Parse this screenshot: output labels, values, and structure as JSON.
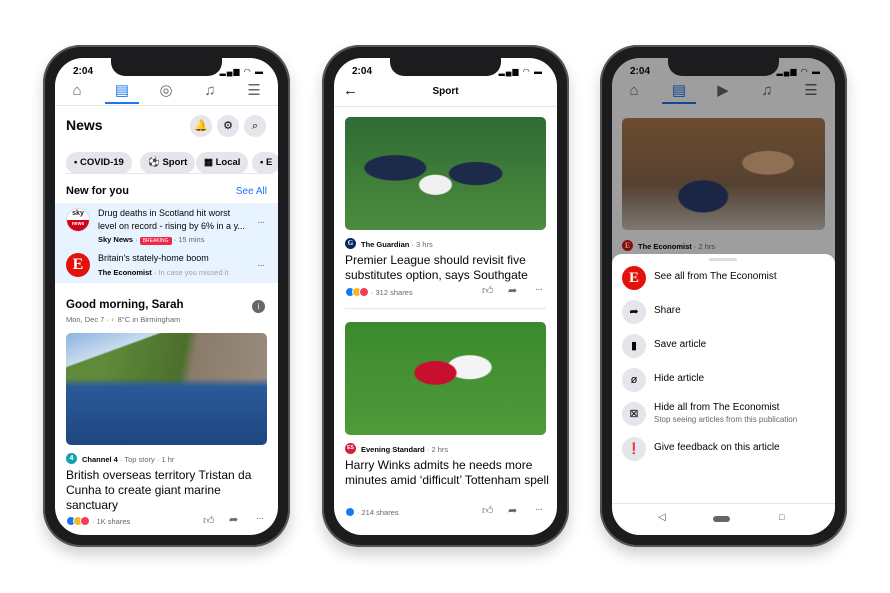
{
  "status_time": "2:04",
  "phone1": {
    "nav": [
      "home-icon",
      "news-icon",
      "groups-icon",
      "bell-icon",
      "menu-icon"
    ],
    "title": "News",
    "header_icons": [
      "bell-icon",
      "gear-icon",
      "search-icon"
    ],
    "chips": [
      {
        "label": "COVID-19",
        "icon": "briefcase-icon"
      },
      {
        "label": "Sport",
        "icon": "football-icon"
      },
      {
        "label": "Local",
        "icon": "city-icon"
      },
      {
        "label": "E",
        "icon": "film-icon"
      }
    ],
    "new_for_you": {
      "title": "New for you",
      "see_all": "See All",
      "items": [
        {
          "headline": "Drug deaths in Scotland hit worst level on record - rising by 6% in a y...",
          "source": "Sky News",
          "badge": "BREAKING",
          "time": "15 mins",
          "logo_top": "sky",
          "logo_bottom": "news"
        },
        {
          "headline": "Britain's stately-home boom",
          "source": "The Economist",
          "time": "In case you missed it",
          "logo": "E"
        }
      ]
    },
    "greeting": {
      "title": "Good morning, Sarah",
      "date": "Mon, Dec 7",
      "weather": "8°C in Birmingham"
    },
    "story": {
      "source": "Channel 4",
      "logo": "4",
      "label": "Top story",
      "time": "1 hr",
      "headline": "British overseas territory Tristan da Cunha to create giant marine sanctuary",
      "shares": "1K shares"
    }
  },
  "phone2": {
    "title": "Sport",
    "articles": [
      {
        "source": "The Guardian",
        "logo": "G",
        "time": "3 hrs",
        "headline": "Premier League should revisit five substitutes option, says Southgate",
        "shares": "312 shares"
      },
      {
        "source": "Evening Standard",
        "logo": "ES",
        "time": "2 hrs",
        "headline": "Harry Winks admits he needs more minutes amid ‘difficult’ Tottenham spell",
        "shares": "214 shares"
      }
    ]
  },
  "phone3": {
    "source": "The Economist",
    "logo": "E",
    "time": "2 hrs",
    "menu": [
      {
        "label": "See all from The Economist",
        "icon": "economist-logo"
      },
      {
        "label": "Share",
        "icon": "share-icon"
      },
      {
        "label": "Save article",
        "icon": "bookmark-icon"
      },
      {
        "label": "Hide article",
        "icon": "hide-icon"
      },
      {
        "label": "Hide all from The Economist",
        "sub": "Stop seeing articles from this publication",
        "icon": "close-box-icon"
      },
      {
        "label": "Give feedback on this article",
        "icon": "feedback-icon"
      }
    ]
  },
  "colors": {
    "accent": "#1877f2",
    "highlight": "#e7f3ff",
    "economist": "#e3120b",
    "breaking": "#f02849"
  }
}
